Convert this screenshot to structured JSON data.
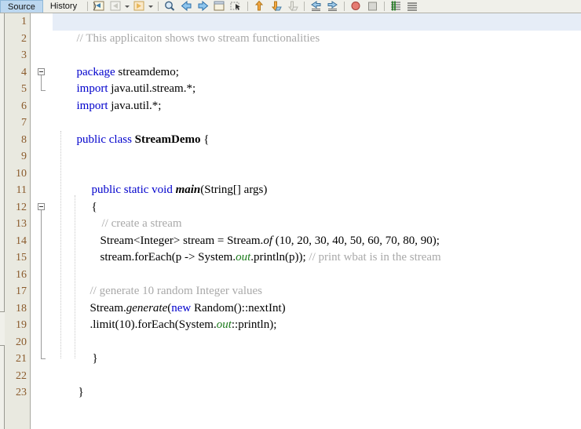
{
  "toolbar": {
    "tabs": [
      {
        "label": "Source",
        "selected": true
      },
      {
        "label": "History",
        "selected": false
      }
    ],
    "icons": [
      "back-to-source-icon",
      "navigate-back-icon",
      "navigate-back-dropdown-caret",
      "navigate-forward-icon",
      "navigate-forward-dropdown-caret",
      "find-selection-icon",
      "previous-bookmark-icon",
      "next-bookmark-icon",
      "toggle-bookmark-icon",
      "toggle-rectangular-selection-icon",
      "previous-error-icon",
      "next-error-icon",
      "shift-line-left-icon",
      "shift-line-right-icon",
      "start-macro-recording-icon",
      "stop-macro-recording-icon",
      "comment-icon",
      "uncomment-icon"
    ]
  },
  "editor": {
    "current_line": 1,
    "line_numbers": [
      1,
      2,
      3,
      4,
      5,
      6,
      7,
      8,
      9,
      10,
      11,
      12,
      13,
      14,
      15,
      16,
      17,
      18,
      19,
      20,
      21,
      22,
      23
    ],
    "lines": [
      {
        "n": 1,
        "text": "// This applicaiton shows two stream functionalities"
      },
      {
        "n": 2,
        "text": ""
      },
      {
        "n": 3,
        "text": "package streamdemo;"
      },
      {
        "n": 4,
        "text": "import java.util.stream.*;"
      },
      {
        "n": 5,
        "text": "import java.util.*;"
      },
      {
        "n": 6,
        "text": ""
      },
      {
        "n": 7,
        "text": "public class StreamDemo {"
      },
      {
        "n": 8,
        "text": ""
      },
      {
        "n": 9,
        "text": ""
      },
      {
        "n": 10,
        "text": "    public static void main(String[] args)"
      },
      {
        "n": 11,
        "text": "    {"
      },
      {
        "n": 12,
        "text": "       // create a stream"
      },
      {
        "n": 13,
        "text": "       Stream<Integer> stream = Stream.of (10, 20, 30, 40, 50, 60, 70, 80, 90);"
      },
      {
        "n": 14,
        "text": "       stream.forEach(p -> System.out.println(p)); // print wbat is in the stream"
      },
      {
        "n": 15,
        "text": ""
      },
      {
        "n": 16,
        "text": "    // generate 10 random Integer values"
      },
      {
        "n": 17,
        "text": "    Stream.generate(new Random()::nextInt)"
      },
      {
        "n": 18,
        "text": "    .limit(10).forEach(System.out::println);"
      },
      {
        "n": 19,
        "text": ""
      },
      {
        "n": 20,
        "text": "    }"
      },
      {
        "n": 21,
        "text": ""
      },
      {
        "n": 22,
        "text": "}"
      },
      {
        "n": 23,
        "text": ""
      }
    ],
    "tokens": {
      "l1_comment": "// This applicaiton shows two stream functionalities",
      "l3_kw": "package",
      "l3_rest": " streamdemo;",
      "l4_kw": "import",
      "l4_rest": " java.util.stream.*;",
      "l5_kw": "import",
      "l5_rest": " java.util.*;",
      "l7_kw": "public class ",
      "l7_cls": "StreamDemo",
      "l7_rest": " {",
      "l10_kw": "public static void ",
      "l10_mth": "main",
      "l10_rest": "(String[] args)",
      "l11_text": "{",
      "l12_comment": "// create a stream",
      "l13_a": "Stream<Integer> stream = Stream.",
      "l13_itl": "of",
      "l13_b": " (10, 20, 30, 40, 50, 60, 70, 80, 90);",
      "l14_a": "stream.forEach(p -> System.",
      "l14_fld": "out",
      "l14_b": ".println(p)); ",
      "l14_comment": "// print wbat is in the stream",
      "l16_comment": "// generate 10 random Integer values",
      "l17_a": "Stream.",
      "l17_itl": "generate",
      "l17_b": "(",
      "l17_kw": "new",
      "l17_c": " Random()::nextInt)",
      "l18_a": ".limit(10).forEach(System.",
      "l18_fld": "out",
      "l18_b": "::println);",
      "l20_text": "}",
      "l22_text": "}"
    },
    "fold_markers": [
      {
        "line": 4,
        "type": "collapse-box"
      },
      {
        "line": 5,
        "type": "fold-end"
      },
      {
        "line": 11,
        "type": "collapse-box"
      },
      {
        "line": 20,
        "type": "fold-end"
      }
    ]
  },
  "colors": {
    "keyword": "#0000cc",
    "comment": "#a9a9a9",
    "field": "#1a7a1a",
    "line_number": "#8a5a2b",
    "current_line_bg": "#e6edf7",
    "gutter_bg": "#e9e9e0",
    "toolbar_bg": "#f0f0ea",
    "tab_selected_bg": "#bcd7ef"
  }
}
